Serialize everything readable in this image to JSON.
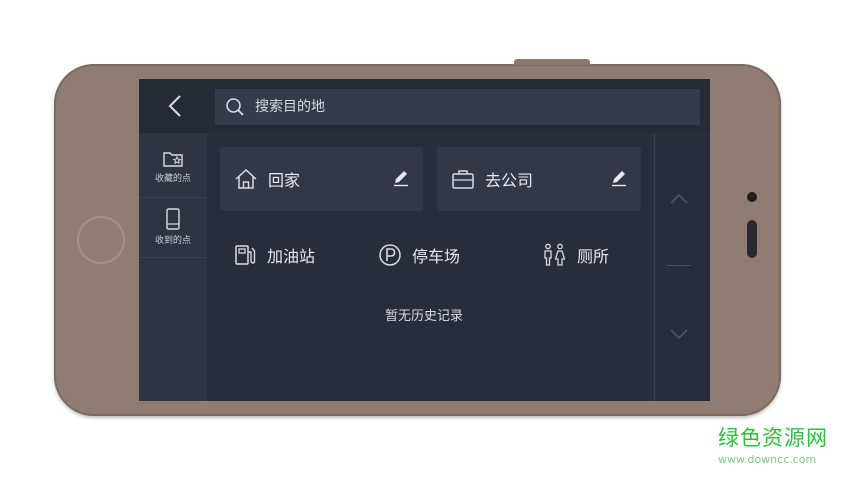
{
  "search": {
    "placeholder": "搜索目的地"
  },
  "sidebar": {
    "items": [
      {
        "label": "收藏的点",
        "icon": "favorite-folder-icon"
      },
      {
        "label": "收到的点",
        "icon": "phone-received-icon"
      }
    ]
  },
  "shortcuts": {
    "home": {
      "label": "回家",
      "icon": "home-icon"
    },
    "company": {
      "label": "去公司",
      "icon": "briefcase-icon"
    }
  },
  "quick_search": [
    {
      "label": "加油站",
      "icon": "gas-station-icon"
    },
    {
      "label": "停车场",
      "icon": "parking-icon"
    },
    {
      "label": "厕所",
      "icon": "restroom-icon"
    }
  ],
  "history": {
    "empty_text": "暂无历史记录"
  },
  "watermark": {
    "title": "绿色资源网",
    "url": "www.downcc.com"
  },
  "colors": {
    "phone_body": "#8f7d72",
    "screen_bg": "#282d3b",
    "card_bg": "#323848",
    "text": "#e7e9ed",
    "watermark_green": "#2bbf3a"
  }
}
